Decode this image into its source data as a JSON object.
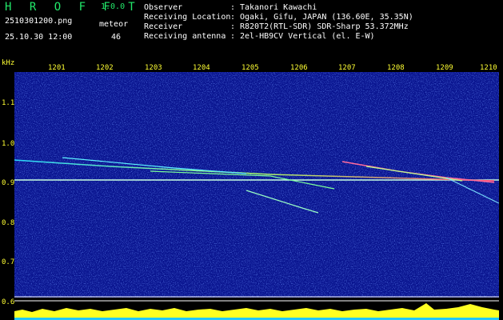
{
  "app": {
    "logo": "H R O F F T",
    "version": "1.0.0"
  },
  "file": {
    "name": "2510301200.png",
    "datetime": "25.10.30 12:00"
  },
  "meteor": {
    "label": "meteor",
    "count": "46"
  },
  "meta": [
    {
      "label": "Observer",
      "value": "Takanori Kawachi"
    },
    {
      "label": "Receiving Location",
      "value": "Ogaki, Gifu, JAPAN (136.60E, 35.35N)"
    },
    {
      "label": "Receiver",
      "value": "R820T2(RTL-SDR) SDR-Sharp 53.372MHz"
    },
    {
      "label": "Receiving antenna",
      "value": "2el-HB9CV Vertical (el. E-W)"
    }
  ],
  "axes": {
    "y_unit": "kHz",
    "x_ticks": [
      "1201",
      "1202",
      "1203",
      "1204",
      "1205",
      "1206",
      "1207",
      "1208",
      "1209",
      "1210"
    ],
    "y_ticks": [
      "1.1",
      "1.0",
      "0.9",
      "0.8",
      "0.7",
      "0.6"
    ]
  },
  "colors": {
    "label": "#22e86a",
    "text": "#ffffff",
    "tick": "#ffff33",
    "background": "#0a1590",
    "carrier": "#c8ffe0"
  }
}
